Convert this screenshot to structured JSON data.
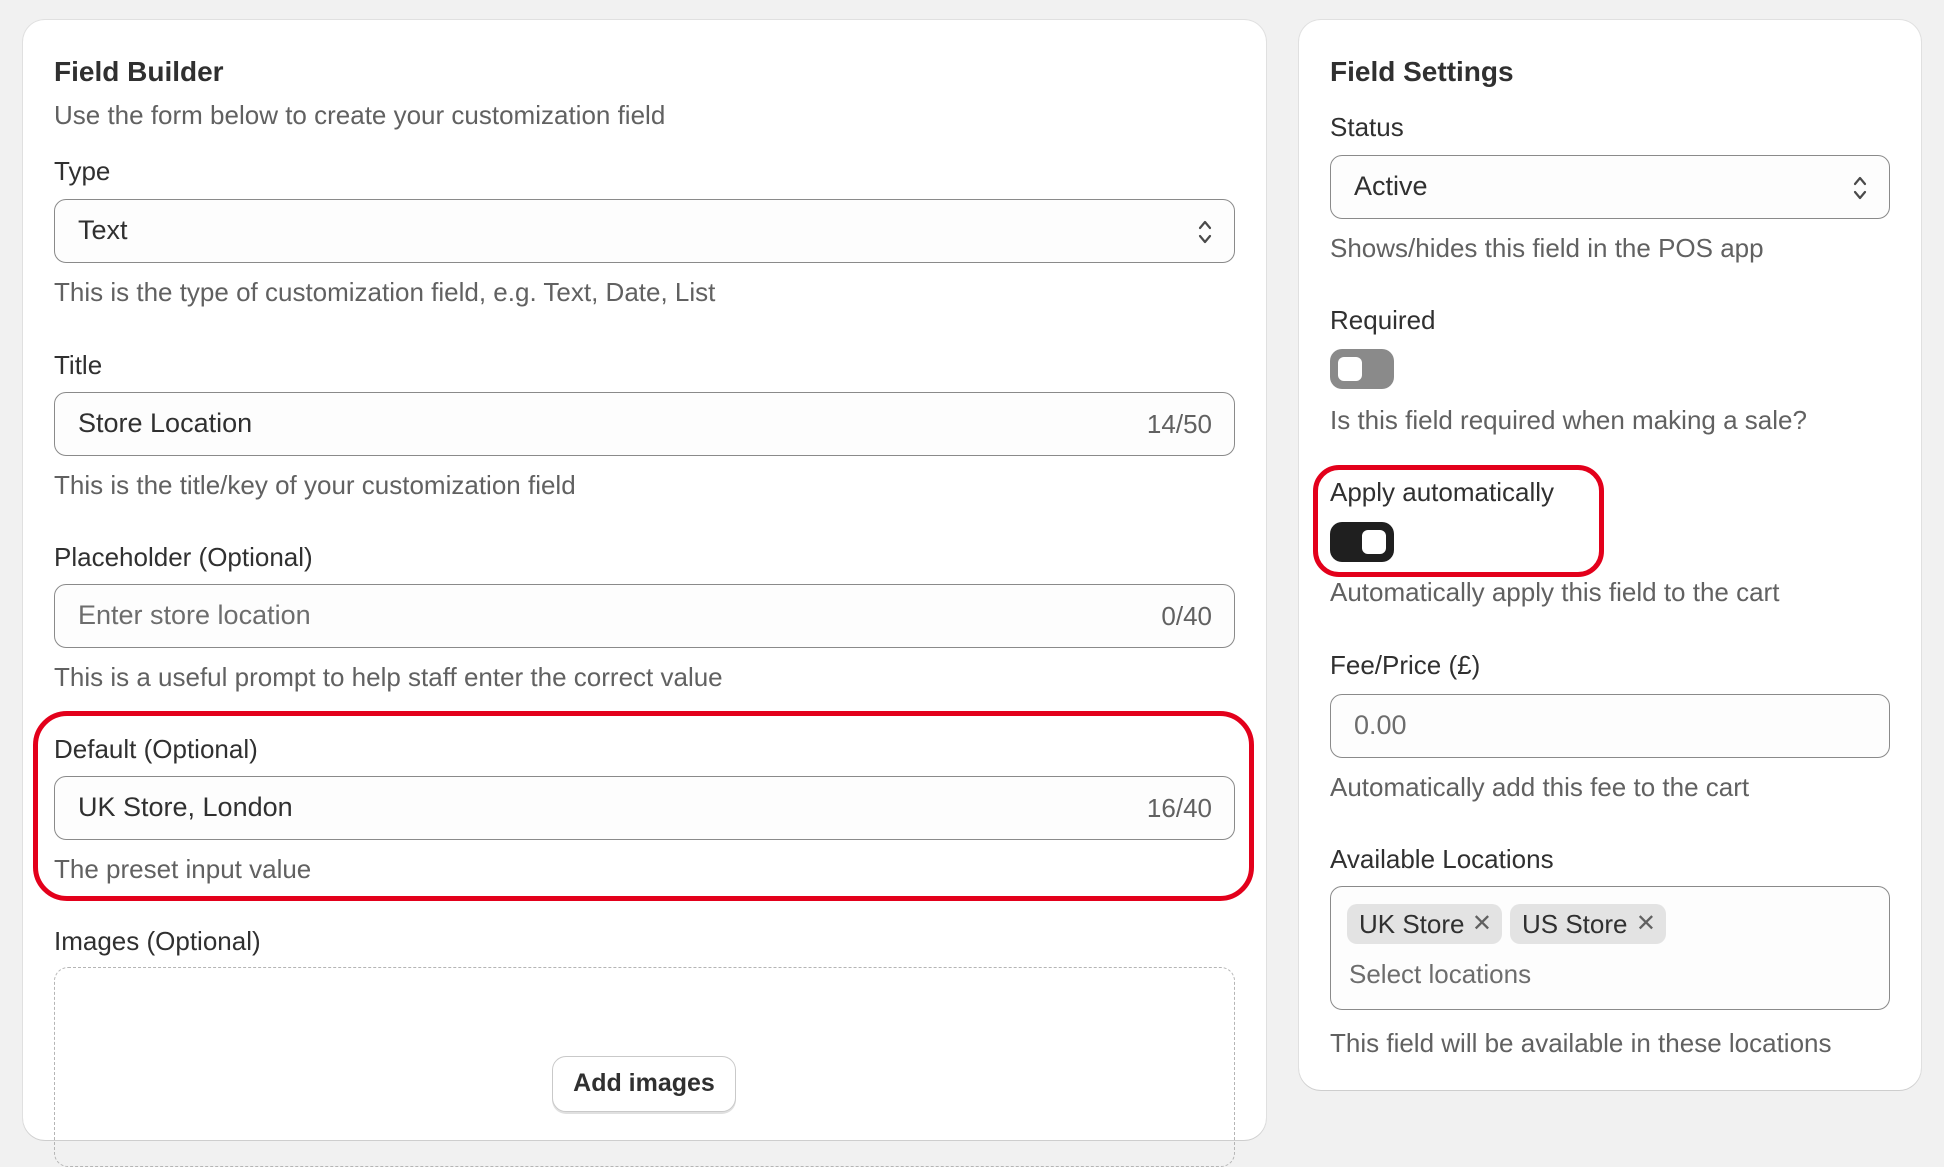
{
  "field_builder": {
    "title": "Field Builder",
    "subtitle": "Use the form below to create your customization field",
    "type": {
      "label": "Type",
      "value": "Text",
      "help": "This is the type of customization field, e.g. Text, Date, List"
    },
    "title_field": {
      "label": "Title",
      "value": "Store Location",
      "counter": "14/50",
      "help": "This is the title/key of your customization field"
    },
    "placeholder_field": {
      "label": "Placeholder (Optional)",
      "placeholder": "Enter store location",
      "counter": "0/40",
      "help": "This is a useful prompt to help staff enter the correct value"
    },
    "default_field": {
      "label": "Default (Optional)",
      "value": "UK Store, London",
      "counter": "16/40",
      "help": "The preset input value"
    },
    "images": {
      "label": "Images (Optional)",
      "button": "Add images"
    }
  },
  "field_settings": {
    "title": "Field Settings",
    "status": {
      "label": "Status",
      "value": "Active",
      "help": "Shows/hides this field in the POS app"
    },
    "required": {
      "label": "Required",
      "on": false,
      "help": "Is this field required when making a sale?"
    },
    "apply_automatically": {
      "label": "Apply automatically",
      "on": true,
      "help": "Automatically apply this field to the cart"
    },
    "fee": {
      "label": "Fee/Price (£)",
      "placeholder": "0.00",
      "help": "Automatically add this fee to the cart"
    },
    "locations": {
      "label": "Available Locations",
      "tags": [
        "UK Store",
        "US Store"
      ],
      "placeholder": "Select locations",
      "help": "This field will be available in these locations"
    }
  },
  "colors": {
    "highlight": "#e3001b",
    "toggle_on": "#1f1f1f",
    "toggle_off": "#8a8a8a"
  }
}
